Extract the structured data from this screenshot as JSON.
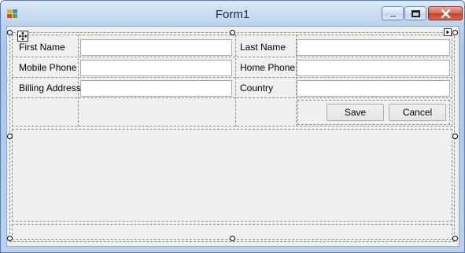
{
  "window": {
    "title": "Form1",
    "icon": "winforms-app-icon",
    "controls": [
      "minimize-icon",
      "maximize-icon",
      "close-icon"
    ]
  },
  "form": {
    "fields": [
      {
        "label": "First Name",
        "value": ""
      },
      {
        "label": "Last Name",
        "value": ""
      },
      {
        "label": "Mobile Phone",
        "value": ""
      },
      {
        "label": "Home Phone",
        "value": ""
      },
      {
        "label": "Billing Address",
        "value": ""
      },
      {
        "label": "Country",
        "value": ""
      }
    ],
    "save_label": "Save",
    "cancel_label": "Cancel"
  },
  "designer": {
    "move_glyph": "move-arrows-icon",
    "smart_tag": "smart-tag-arrow-icon"
  },
  "colors": {
    "titlebar": "#bcd3ee",
    "client": "#f0f0f0",
    "close_button": "#c4422a"
  }
}
